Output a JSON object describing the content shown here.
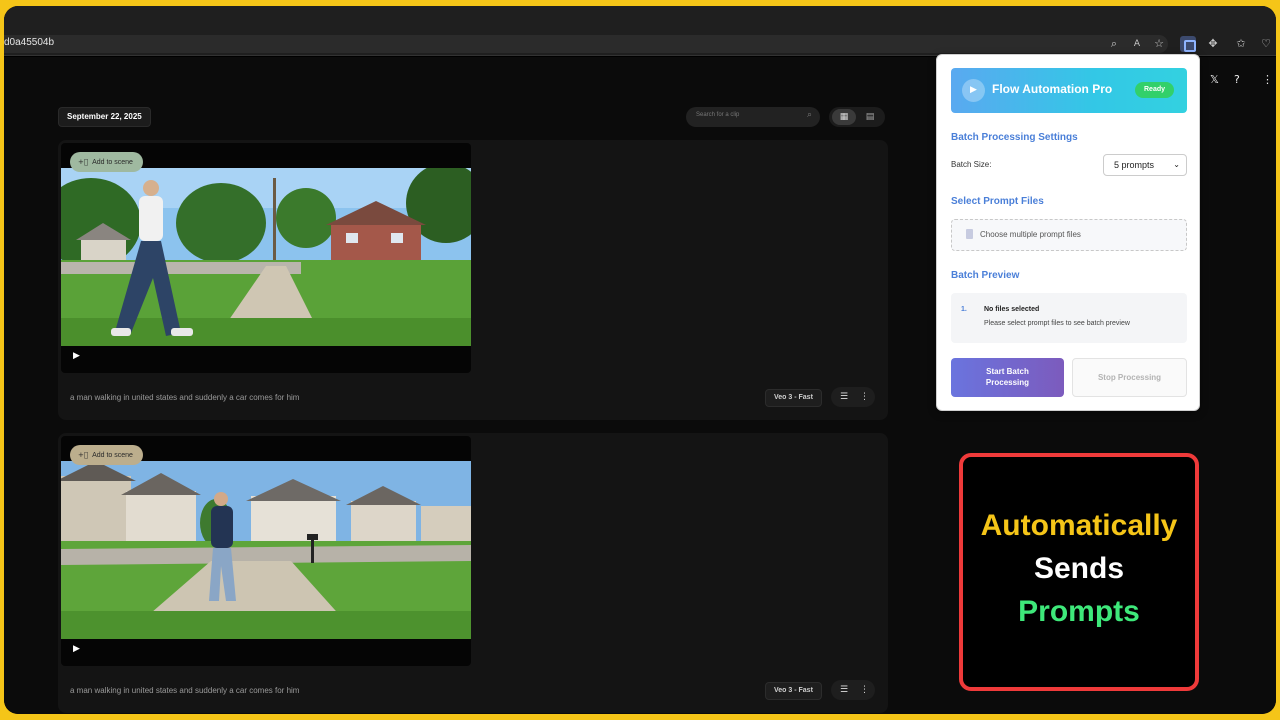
{
  "browser": {
    "url": "d0a45504b",
    "icons": [
      "zoom-icon",
      "read-aloud-icon",
      "favorite-star-icon",
      "extension-active-icon",
      "extensions-puzzle-icon",
      "favorites-icon",
      "browser-essentials-icon"
    ]
  },
  "page": {
    "date_label": "September 22, 2025",
    "search_placeholder": "Search for a clip",
    "top_icons": [
      "x-logo-icon",
      "help-icon",
      "more-vert-icon"
    ],
    "clips": [
      {
        "add_to_scene": "Add to scene",
        "caption": "a man walking in united states and suddenly a car comes for him",
        "model": "Veo 3 - Fast"
      },
      {
        "add_to_scene": "Add to scene",
        "caption": "a man walking in united states and suddenly a car comes for him",
        "model": "Veo 3 - Fast"
      }
    ]
  },
  "popup": {
    "title": "Flow Automation Pro",
    "status": "Ready",
    "batch_settings_title": "Batch Processing Settings",
    "batch_size_label": "Batch Size:",
    "batch_size_value": "5 prompts",
    "select_files_title": "Select Prompt Files",
    "file_button_label": "Choose multiple prompt files",
    "batch_preview_title": "Batch Preview",
    "preview": {
      "index": "1.",
      "title": "No files selected",
      "description": "Please select prompt files to see batch preview"
    },
    "start_button": "Start Batch Processing",
    "stop_button": "Stop Processing",
    "accent_color": "#4a7fd8",
    "status_color": "#32d06a"
  },
  "callout": {
    "line1": "Automatically",
    "line2": "Sends",
    "line3": "Prompts",
    "colors": {
      "line1": "#f5c518",
      "line2": "#ffffff",
      "line3": "#3ee87a",
      "border": "#ef3a3a"
    }
  }
}
